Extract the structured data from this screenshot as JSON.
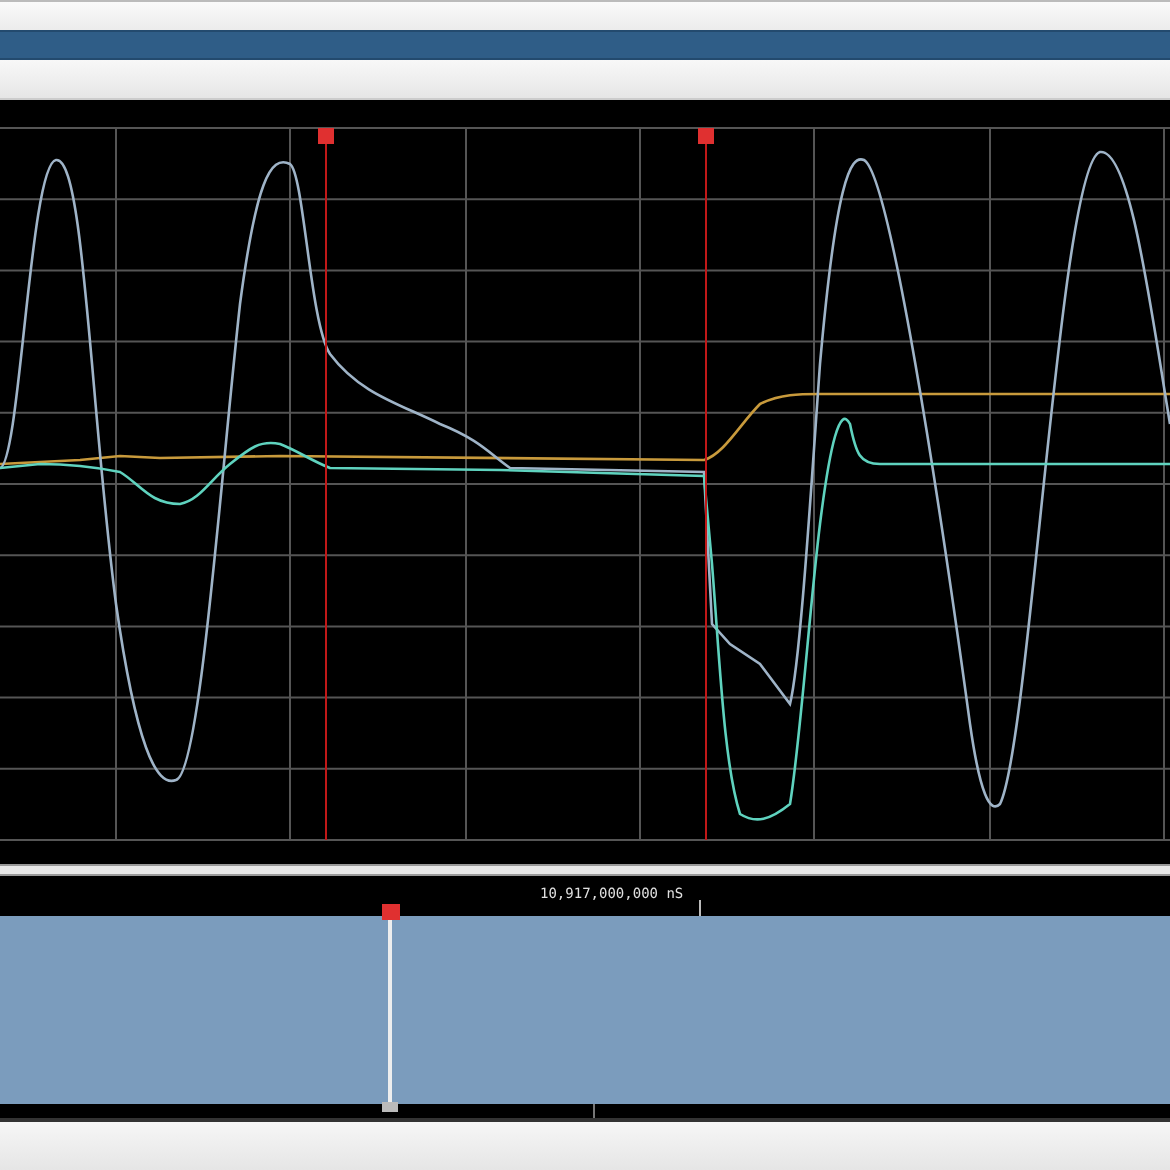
{
  "overview": {
    "time_label": "10,917,000,000 nS"
  }
}
